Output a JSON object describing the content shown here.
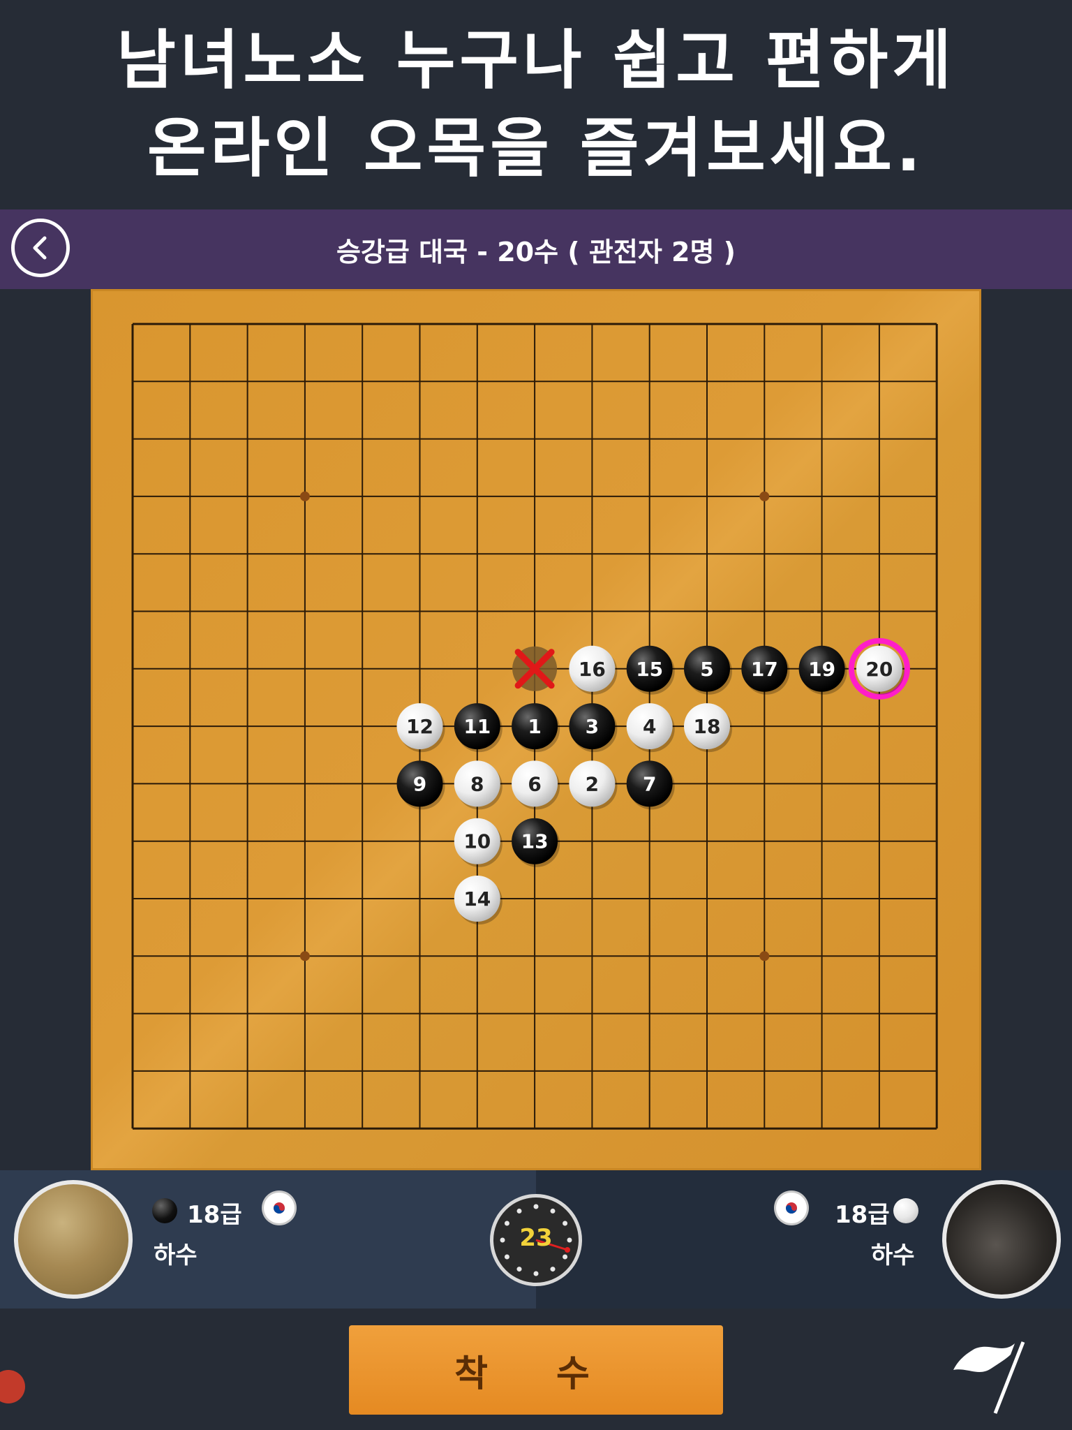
{
  "promo": {
    "line1": "남녀노소 누구나 쉽고 편하게",
    "line2": "온라인 오목을 즐겨보세요."
  },
  "header": {
    "title": "승강급 대국 - 20수 ( 관전자 2명 )",
    "back_icon": "chevron-left-icon"
  },
  "board": {
    "size": 15,
    "star_points": [
      [
        3,
        3
      ],
      [
        3,
        11
      ],
      [
        11,
        3
      ],
      [
        11,
        11
      ]
    ],
    "last_move": 20,
    "removed_mark": {
      "row": 6,
      "col": 7,
      "icon": "red-x-icon"
    },
    "stones": [
      {
        "n": 1,
        "color": "black",
        "row": 7,
        "col": 7
      },
      {
        "n": 2,
        "color": "white",
        "row": 8,
        "col": 8
      },
      {
        "n": 3,
        "color": "black",
        "row": 7,
        "col": 8
      },
      {
        "n": 4,
        "color": "white",
        "row": 7,
        "col": 9
      },
      {
        "n": 5,
        "color": "black",
        "row": 6,
        "col": 10
      },
      {
        "n": 6,
        "color": "white",
        "row": 8,
        "col": 7
      },
      {
        "n": 7,
        "color": "black",
        "row": 8,
        "col": 9
      },
      {
        "n": 8,
        "color": "white",
        "row": 8,
        "col": 6
      },
      {
        "n": 9,
        "color": "black",
        "row": 8,
        "col": 5
      },
      {
        "n": 10,
        "color": "white",
        "row": 9,
        "col": 6
      },
      {
        "n": 11,
        "color": "black",
        "row": 7,
        "col": 6
      },
      {
        "n": 12,
        "color": "white",
        "row": 7,
        "col": 5
      },
      {
        "n": 13,
        "color": "black",
        "row": 9,
        "col": 7
      },
      {
        "n": 14,
        "color": "white",
        "row": 10,
        "col": 6
      },
      {
        "n": 15,
        "color": "black",
        "row": 6,
        "col": 9
      },
      {
        "n": 16,
        "color": "white",
        "row": 6,
        "col": 8
      },
      {
        "n": 17,
        "color": "black",
        "row": 6,
        "col": 11
      },
      {
        "n": 18,
        "color": "white",
        "row": 7,
        "col": 10
      },
      {
        "n": 19,
        "color": "black",
        "row": 6,
        "col": 12
      },
      {
        "n": 20,
        "color": "white",
        "row": 6,
        "col": 13
      }
    ]
  },
  "player_left": {
    "rank": "18급",
    "nickname": "하수",
    "stone": "black",
    "flag_icon": "korea-flag-icon"
  },
  "player_right": {
    "rank": "18급",
    "nickname": "하수",
    "stone": "white",
    "flag_icon": "korea-flag-icon"
  },
  "timer": {
    "seconds": "23"
  },
  "actions": {
    "place_label": "착 수",
    "resign_icon": "white-flag-icon"
  },
  "colors": {
    "header_bg": "#463460",
    "board": "#d9962f",
    "last_move_ring": "#ff1ec8",
    "place_button": "#e98f2a"
  }
}
